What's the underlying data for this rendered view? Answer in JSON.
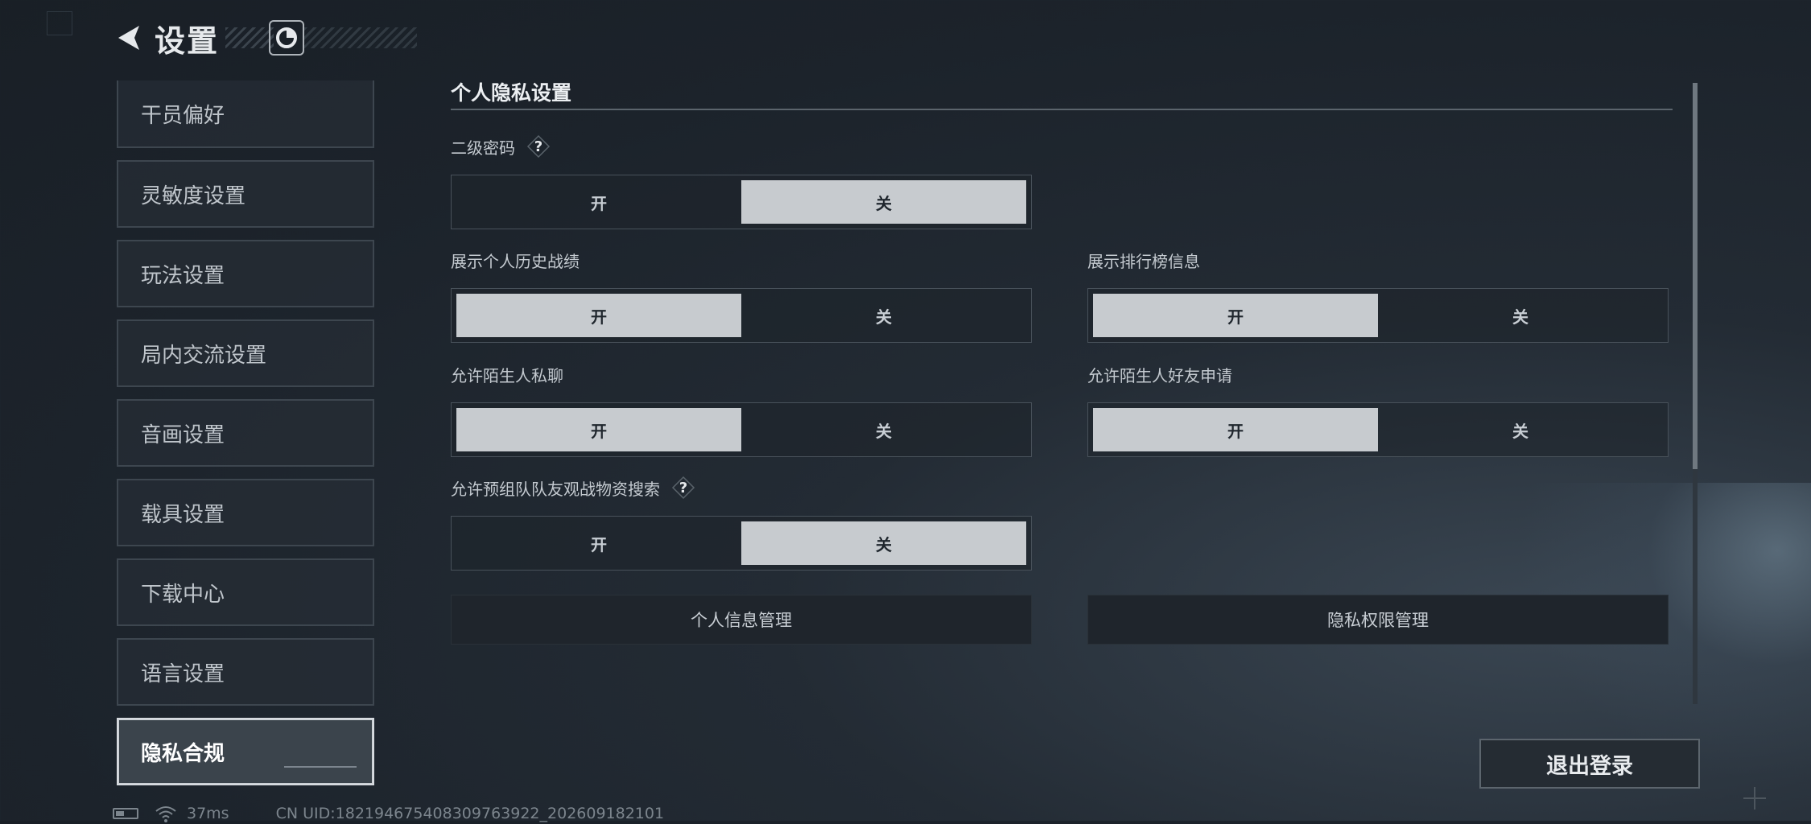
{
  "header": {
    "title": "设置"
  },
  "sidebar": {
    "items": [
      {
        "label": "干员偏好"
      },
      {
        "label": "灵敏度设置"
      },
      {
        "label": "玩法设置"
      },
      {
        "label": "局内交流设置"
      },
      {
        "label": "音画设置"
      },
      {
        "label": "载具设置"
      },
      {
        "label": "下载中心"
      },
      {
        "label": "语言设置"
      },
      {
        "label": "隐私合规",
        "active": true
      }
    ]
  },
  "privacy": {
    "section_title": "个人隐私设置",
    "options": {
      "on": "开",
      "off": "关"
    },
    "settings": [
      {
        "label": "二级密码",
        "selected": "关",
        "has_help": true
      },
      {
        "label": "展示个人历史战绩",
        "selected": "开"
      },
      {
        "label": "展示排行榜信息",
        "selected": "开"
      },
      {
        "label": "允许陌生人私聊",
        "selected": "开"
      },
      {
        "label": "允许陌生人好友申请",
        "selected": "开"
      },
      {
        "label": "允许预组队队友观战物资搜索",
        "selected": "关",
        "has_help": true
      }
    ],
    "buttons": {
      "personal_info": "个人信息管理",
      "privacy_permissions": "隐私权限管理"
    }
  },
  "logout_label": "退出登录",
  "status_bar": {
    "ping": "37ms",
    "uid": "CN UID:1821946754083097639​22_202609182101"
  },
  "icons": {
    "back": "back-arrow-icon",
    "logo": "brand-logo-icon",
    "help": "question-icon",
    "battery": "battery-icon",
    "wifi": "wifi-icon"
  },
  "colors": {
    "selected_bg": "#c7cbcf",
    "background": "#1c232b"
  }
}
